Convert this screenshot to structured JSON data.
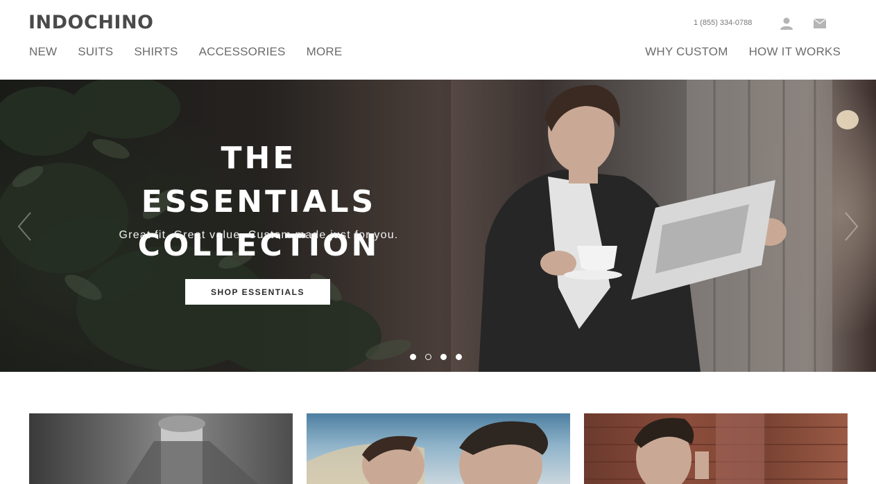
{
  "header": {
    "logo": "INDOCHINO",
    "phone": "1 (855) 334-0788",
    "icons": {
      "account": "user-icon",
      "cart": "cart-icon"
    },
    "nav_left": [
      "NEW",
      "SUITS",
      "SHIRTS",
      "ACCESSORIES",
      "MORE"
    ],
    "nav_right": [
      "WHY CUSTOM",
      "HOW IT WORKS"
    ]
  },
  "hero": {
    "title_line1": "THE ESSENTIALS",
    "title_line2": "COLLECTION",
    "subtitle": "Great fit. Great value. Custom made just for you.",
    "button": "SHOP ESSENTIALS",
    "slide_count": 4,
    "active_slide": 2,
    "icons": {
      "prev": "chevron-left-icon",
      "next": "chevron-right-icon"
    }
  },
  "colors": {
    "nav_text": "#6b6b6b",
    "logo": "#4a4a4a",
    "hero_text": "#ffffff"
  }
}
